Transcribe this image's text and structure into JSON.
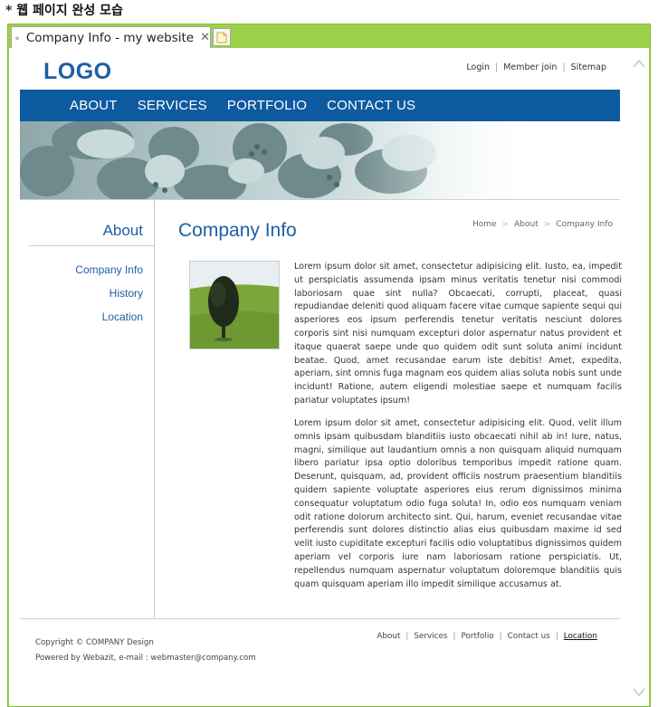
{
  "caption": "* 웹 페이지 완성 모습",
  "browser": {
    "tab_title": "Company Info - my website",
    "tab_close": "✕"
  },
  "header": {
    "logo": "LOGO",
    "top_links": [
      "Login",
      "Member join",
      "Sitemap"
    ]
  },
  "nav": {
    "items": [
      "ABOUT",
      "SERVICES",
      "PORTFOLIO",
      "CONTACT US"
    ]
  },
  "sidebar": {
    "title": "About",
    "items": [
      "Company Info",
      "History",
      "Location"
    ]
  },
  "content": {
    "title": "Company Info",
    "breadcrumb": [
      "Home",
      "About",
      "Company Info"
    ],
    "paragraph1": "Lorem ipsum dolor sit amet, consectetur adipisicing elit. Iusto, ea, impedit ut perspiciatis assumenda ipsam minus veritatis tenetur nisi commodi laboriosam quae sint nulla? Obcaecati, corrupti, placeat, quasi repudiandae deleniti quod aliquam facere vitae cumque sapiente sequi qui asperiores eos ipsum perferendis tenetur veritatis nesciunt dolores corporis sint nisi numquam excepturi dolor aspernatur natus provident et itaque quaerat saepe unde quo quidem odit sunt soluta animi incidunt beatae. Quod, amet recusandae earum iste debitis! Amet, expedita, aperiam, sint omnis fuga magnam eos quidem alias soluta nobis sunt unde incidunt! Ratione, autem eligendi molestiae saepe et numquam facilis pariatur voluptates ipsum!",
    "paragraph2": "Lorem ipsum dolor sit amet, consectetur adipisicing elit. Quod, velit illum omnis ipsam quibusdam blanditiis iusto obcaecati nihil ab in! Iure, natus, magni, similique aut laudantium omnis a non quisquam aliquid numquam libero pariatur ipsa optio doloribus temporibus impedit ratione quam. Deserunt, quisquam, ad, provident officiis nostrum praesentium blanditiis quidem sapiente voluptate asperiores eius rerum dignissimos minima consequatur voluptatum odio fuga soluta! In, odio eos numquam veniam odit ratione dolorum architecto sint. Qui, harum, eveniet recusandae vitae perferendis sunt dolores distinctio alias eius quibusdam maxime id sed velit iusto cupiditate excepturi facilis odio voluptatibus dignissimos quidem aperiam vel corporis iure nam laboriosam ratione perspiciatis. Ut, repellendus numquam aspernatur voluptatum doloremque blanditiis quis quam quisquam aperiam illo impedit similique accusamus at."
  },
  "footer": {
    "copyright": "Copyright © COMPANY Design",
    "powered": "Powered by Webazit, e-mail : webmaster@company.com",
    "links": [
      "About",
      "Services",
      "Portfolio",
      "Contact us",
      "Location"
    ]
  },
  "colors": {
    "brand_blue": "#1f5ea3",
    "nav_bg": "#0e5aa0",
    "browser_frame": "#9ed14a"
  },
  "icons": {
    "tab": "ie-browser-icon",
    "new_tab": "new-tab-icon",
    "scroll_up": "chevron-up-icon",
    "scroll_down": "chevron-down-icon"
  }
}
